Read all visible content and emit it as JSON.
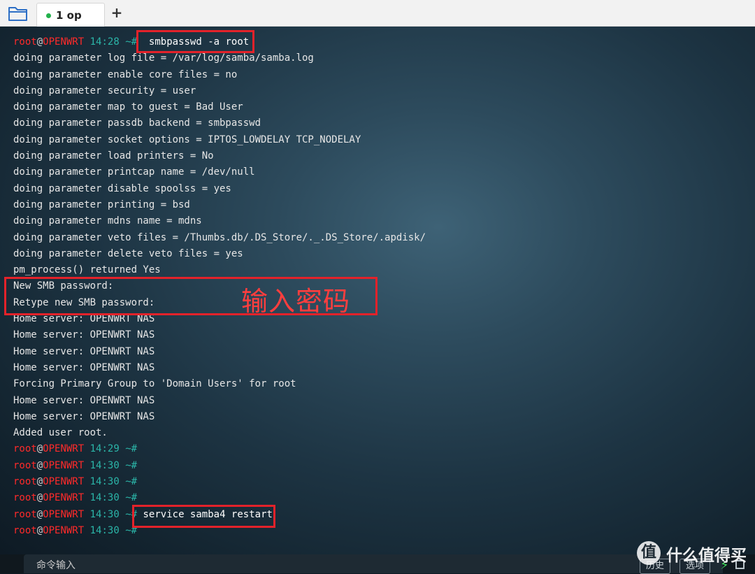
{
  "tabbar": {
    "tab_label": "1 op",
    "new_tab": "+"
  },
  "terminal": {
    "prompt": {
      "user": "root",
      "at": "@",
      "host": "OPENWRT",
      "path": "~#"
    },
    "lines": [
      {
        "kind": "prompt",
        "time": "14:28",
        "cmd": "  smbpasswd -a root"
      },
      {
        "kind": "out",
        "text": "doing parameter log file = /var/log/samba/samba.log"
      },
      {
        "kind": "out",
        "text": "doing parameter enable core files = no"
      },
      {
        "kind": "out",
        "text": "doing parameter security = user"
      },
      {
        "kind": "out",
        "text": "doing parameter map to guest = Bad User"
      },
      {
        "kind": "out",
        "text": "doing parameter passdb backend = smbpasswd"
      },
      {
        "kind": "out",
        "text": "doing parameter socket options = IPTOS_LOWDELAY TCP_NODELAY"
      },
      {
        "kind": "out",
        "text": "doing parameter load printers = No"
      },
      {
        "kind": "out",
        "text": "doing parameter printcap name = /dev/null"
      },
      {
        "kind": "out",
        "text": "doing parameter disable spoolss = yes"
      },
      {
        "kind": "out",
        "text": "doing parameter printing = bsd"
      },
      {
        "kind": "out",
        "text": "doing parameter mdns name = mdns"
      },
      {
        "kind": "out",
        "text": "doing parameter veto files = /Thumbs.db/.DS_Store/._.DS_Store/.apdisk/"
      },
      {
        "kind": "out",
        "text": "doing parameter delete veto files = yes"
      },
      {
        "kind": "out",
        "text": "pm_process() returned Yes"
      },
      {
        "kind": "out",
        "text": "New SMB password:"
      },
      {
        "kind": "out",
        "text": "Retype new SMB password:"
      },
      {
        "kind": "out",
        "text": "Home server: OPENWRT NAS"
      },
      {
        "kind": "out",
        "text": "Home server: OPENWRT NAS"
      },
      {
        "kind": "out",
        "text": "Home server: OPENWRT NAS"
      },
      {
        "kind": "out",
        "text": "Home server: OPENWRT NAS"
      },
      {
        "kind": "out",
        "text": "Forcing Primary Group to 'Domain Users' for root"
      },
      {
        "kind": "out",
        "text": "Home server: OPENWRT NAS"
      },
      {
        "kind": "out",
        "text": "Home server: OPENWRT NAS"
      },
      {
        "kind": "out",
        "text": "Added user root."
      },
      {
        "kind": "prompt",
        "time": "14:29",
        "cmd": ""
      },
      {
        "kind": "prompt",
        "time": "14:30",
        "cmd": ""
      },
      {
        "kind": "prompt",
        "time": "14:30",
        "cmd": ""
      },
      {
        "kind": "prompt",
        "time": "14:30",
        "cmd": ""
      },
      {
        "kind": "prompt",
        "time": "14:30",
        "cmd": " service samba4 restart"
      },
      {
        "kind": "prompt",
        "time": "14:30",
        "cmd": ""
      }
    ]
  },
  "annotation": {
    "text": "输入密码",
    "color": "#e3222a"
  },
  "bottom": {
    "command_input_label": "命令输入",
    "history_button": "历史",
    "options_button": "选项"
  },
  "watermark": {
    "logo": "值",
    "text": "什么值得买"
  },
  "colors": {
    "user": "#ff2a2a",
    "time": "#2bb5a8",
    "tab_active_dot": "#22b14c"
  }
}
